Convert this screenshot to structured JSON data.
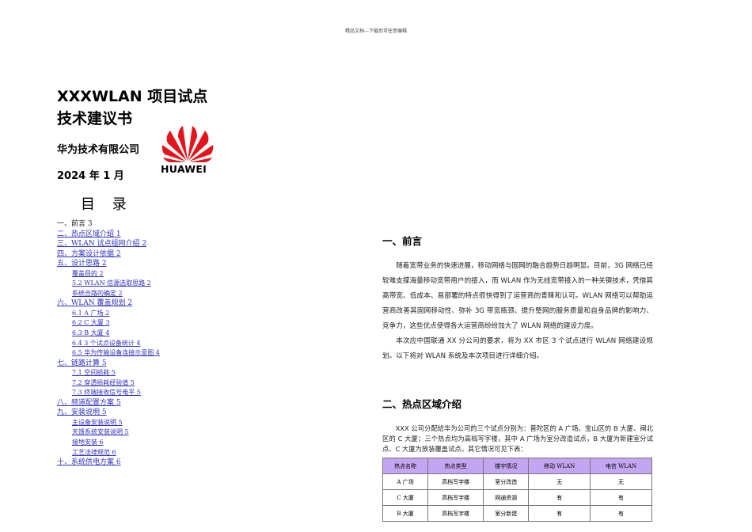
{
  "header_note": "精品文档---下载后可任意编辑",
  "cover": {
    "title_line1": "XXXWLAN 项目试点",
    "title_line2": "技术建议书",
    "company": "华为技术有限公司",
    "date": "2024 年 1 月",
    "logo_text": "HUAWEI",
    "toc_title": "目 录"
  },
  "toc": [
    {
      "label": "一、前言 3",
      "level": 1,
      "link": false
    },
    {
      "label": "二、热点区域介绍 1",
      "level": 1,
      "link": true
    },
    {
      "label": "三、WLAN 试点组网介绍 2",
      "level": 1,
      "link": true
    },
    {
      "label": "四、方案设计依据 2",
      "level": 1,
      "link": true
    },
    {
      "label": "五、设计思路 2",
      "level": 1,
      "link": true
    },
    {
      "label": "覆盖目的 2",
      "level": 2,
      "link": true
    },
    {
      "label": "5.2 WLAN 信源选取思路 2",
      "level": 2,
      "link": true
    },
    {
      "label": "系统合路的确定 2",
      "level": 2,
      "link": true
    },
    {
      "label": "六、WLAN 覆盖规划 2",
      "level": 1,
      "link": true
    },
    {
      "label": "6.1 A 广场 2",
      "level": 2,
      "link": true
    },
    {
      "label": "6.2 C 大厦 3",
      "level": 2,
      "link": true
    },
    {
      "label": "6.3 B 大厦 4",
      "level": 2,
      "link": true
    },
    {
      "label": "6.4 3 个试点设备统计 4",
      "level": 2,
      "link": true
    },
    {
      "label": "6.5 华为传输设备连接示意图 4",
      "level": 2,
      "link": true
    },
    {
      "label": "七、链路计算 5",
      "level": 1,
      "link": true
    },
    {
      "label": "7.1 空间损耗 5",
      "level": 2,
      "link": true
    },
    {
      "label": "7.2 穿透损耗经验值 5",
      "level": 2,
      "link": true
    },
    {
      "label": "7.3 终端接收信号电平 5",
      "level": 2,
      "link": true
    },
    {
      "label": "八、频道配置方案 5",
      "level": 1,
      "link": true
    },
    {
      "label": "九、安装说明 5",
      "level": 1,
      "link": true
    },
    {
      "label": "主设备安装说明 5",
      "level": 2,
      "link": true
    },
    {
      "label": "天馈系统安装说明 5",
      "level": 2,
      "link": true
    },
    {
      "label": "接地安装 6",
      "level": 2,
      "link": true
    },
    {
      "label": "工艺法律规范 6",
      "level": 2,
      "link": true
    },
    {
      "label": "十、系统供电方案 6",
      "level": 1,
      "link": true
    }
  ],
  "section1": {
    "heading": "一、前言",
    "para1": "随着宽带业务的快速进展，移动网络与固网的融合趋势日趋明显。目前，3G 网络已经较难支撑海量移动宽带用户的接入，而 WLAN 作为无线宽带接入的一种关键技术，凭借其高带宽、低成本、易部署的特点很快得到了运营商的青睐和认可。WLAN 网络可以帮助运营商改善其固网移动性、弥补 3G 带宽瓶颈、提升整网的服务质量和自身品牌的影响力、竞争力，这些优点使得各大运营商纷纷加大了 WLAN 网络的建设力度。",
    "para2": "本次应中国联通 XX 分公司的要求，将为 XX 市区 3 个试点进行 WLAN 网络建设规划。以下将对 WLAN 系统及本次项目进行详细介绍。"
  },
  "section2": {
    "heading": "二、热点区域介绍",
    "para": "XXX 公司分配给华为公司的三个试点分别为：普陀区的 A 广场、宝山区的 B 大厦、闸北区的 C 大厦；三个热点均为高档写字楼，其中 A 广场为室分改造试点，B 大厦为新建室分试点、C 大厦为放装覆盖试点。其它情况可见下表：",
    "table": {
      "headers": [
        "热点名称",
        "热点类型",
        "楼宇情况",
        "移动 WLAN",
        "电信 WLAN"
      ],
      "rows": [
        [
          "A 广场",
          "高档写字楼",
          "室分改造",
          "无",
          "无"
        ],
        [
          "C 大厦",
          "高档写字楼",
          "网通资源",
          "有",
          "有"
        ],
        [
          "B 大厦",
          "高档写字楼",
          "室分新建",
          "有",
          "有"
        ]
      ]
    }
  }
}
